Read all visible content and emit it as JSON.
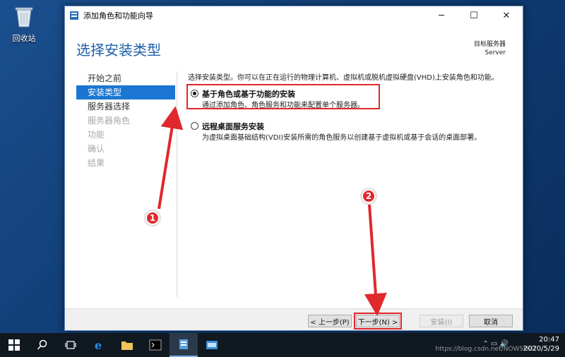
{
  "desktop": {
    "icons": [
      {
        "label": "回收站",
        "icon": "recycle-bin-icon"
      }
    ]
  },
  "window": {
    "title": "添加角色和功能向导",
    "controls": {
      "minimize": "─",
      "maximize": "☐",
      "close": "✕"
    },
    "page_title": "选择安装类型",
    "target_label": "目标服务器",
    "target_value": "Server"
  },
  "nav": {
    "items": [
      {
        "label": "开始之前",
        "state": "normal"
      },
      {
        "label": "安装类型",
        "state": "active"
      },
      {
        "label": "服务器选择",
        "state": "normal"
      },
      {
        "label": "服务器角色",
        "state": "disabled"
      },
      {
        "label": "功能",
        "state": "disabled"
      },
      {
        "label": "确认",
        "state": "disabled"
      },
      {
        "label": "结果",
        "state": "disabled"
      }
    ]
  },
  "content": {
    "intro": "选择安装类型。你可以在正在运行的物理计算机、虚拟机或脱机虚拟硬盘(VHD)上安装角色和功能。",
    "options": [
      {
        "title": "基于角色或基于功能的安装",
        "desc": "通过添加角色、角色服务和功能来配置单个服务器。",
        "selected": true
      },
      {
        "title": "远程桌面服务安装",
        "desc": "为虚拟桌面基础结构(VDI)安装所需的角色服务以创建基于虚拟机或基于会话的桌面部署。",
        "selected": false
      }
    ]
  },
  "footer": {
    "prev": "< 上一步(P)",
    "next": "下一步(N) >",
    "install": "安装(I)",
    "cancel": "取消"
  },
  "annotations": {
    "marker1": "1",
    "marker2": "2",
    "color": "#e0282d"
  },
  "taskbar": {
    "items": [
      "windows-start-icon",
      "search-icon",
      "task-view-icon",
      "ie-icon",
      "file-explorer-icon",
      "cmd-icon",
      "server-manager-icon",
      "other-app-icon"
    ],
    "time": "20:47",
    "date": "2020/5/29",
    "watermark": "https://blog.csdn.net/NOWSHUT"
  }
}
